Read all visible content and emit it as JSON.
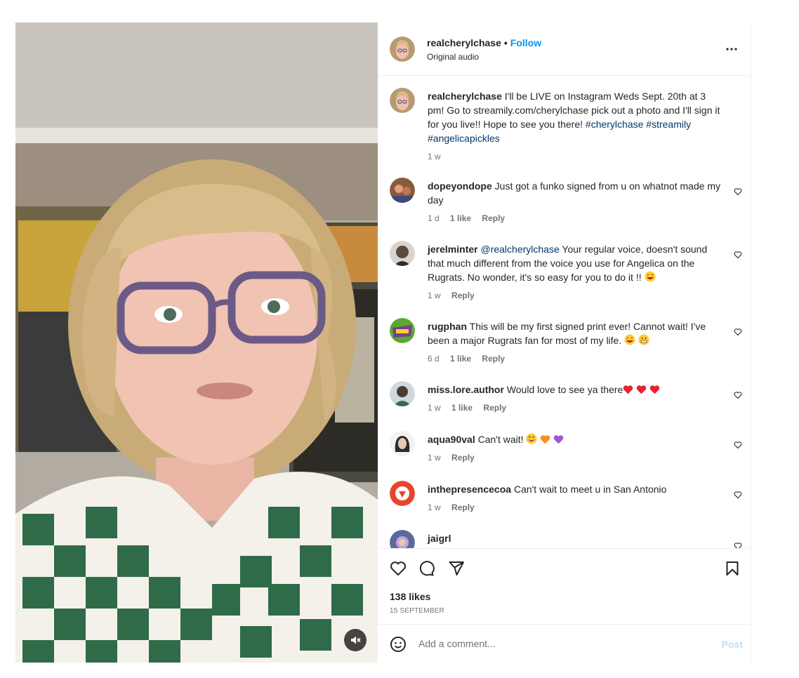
{
  "post": {
    "username": "realcherylchase",
    "separator": "•",
    "follow_label": "Follow",
    "audio_label": "Original audio",
    "more_label": "More options"
  },
  "caption": {
    "username": "realcherylchase",
    "text": "I'll be LIVE on Instagram Weds Sept. 20th at 3 pm! Go to streamily.com/cherylchase pick out a photo and I'll sign it for you live!! Hope to see you there!",
    "tags": [
      "#cherylchase",
      "#streamily",
      "#angelicapickles"
    ],
    "time": "1 w"
  },
  "comments": [
    {
      "username": "dopeyondope",
      "mention": "",
      "text": "Just got a funko signed from u on whatnot made my day",
      "emoji": [],
      "time": "1 d",
      "likes": "1 like",
      "reply": "Reply",
      "avatar_color": "#8a5a3c"
    },
    {
      "username": "jerelminter",
      "mention": "@realcherylchase",
      "text": "Your regular voice, doesn't sound that much different from the voice you use for Angelica on the Rugrats. No wonder, it's so easy for you to do it !!",
      "emoji": [
        "laugh"
      ],
      "time": "1 w",
      "likes": "",
      "reply": "Reply",
      "avatar_color": "#5b4a44"
    },
    {
      "username": "rugphan",
      "mention": "",
      "text": "This will be my first signed print ever! Cannot wait! I've been a major Rugrats fan for most of my life.",
      "emoji": [
        "laugh",
        "grin"
      ],
      "time": "6 d",
      "likes": "1 like",
      "reply": "Reply",
      "avatar_color": "#7a3d8c"
    },
    {
      "username": "miss.lore.author",
      "mention": "",
      "text": "Would love to see ya there",
      "emoji": [
        "heart-red",
        "heart-red",
        "heart-red"
      ],
      "time": "1 w",
      "likes": "1 like",
      "reply": "Reply",
      "avatar_color": "#4b3b35"
    },
    {
      "username": "aqua90val",
      "mention": "",
      "text": "Can't wait!",
      "emoji": [
        "smile",
        "heart-orange",
        "heart-purple"
      ],
      "time": "1 w",
      "likes": "",
      "reply": "Reply",
      "avatar_color": "#2d2d2d"
    },
    {
      "username": "inthepresencecoa",
      "mention": "",
      "text": "Can't wait to meet u in San Antonio",
      "emoji": [],
      "time": "1 w",
      "likes": "",
      "reply": "Reply",
      "avatar_color": "#e8442b"
    },
    {
      "username": "jaigrl",
      "mention": "",
      "text": "",
      "emoji": [],
      "time": "",
      "likes": "",
      "reply": "",
      "avatar_color": "#5a6a9c"
    }
  ],
  "actions": {
    "likes": "138 likes",
    "date": "15 SEPTEMBER"
  },
  "composer": {
    "placeholder": "Add a comment...",
    "post_label": "Post"
  },
  "colors": {
    "link": "#0095f6",
    "hashtag": "#00376b",
    "muted": "#737373",
    "divider": "#efefef"
  }
}
